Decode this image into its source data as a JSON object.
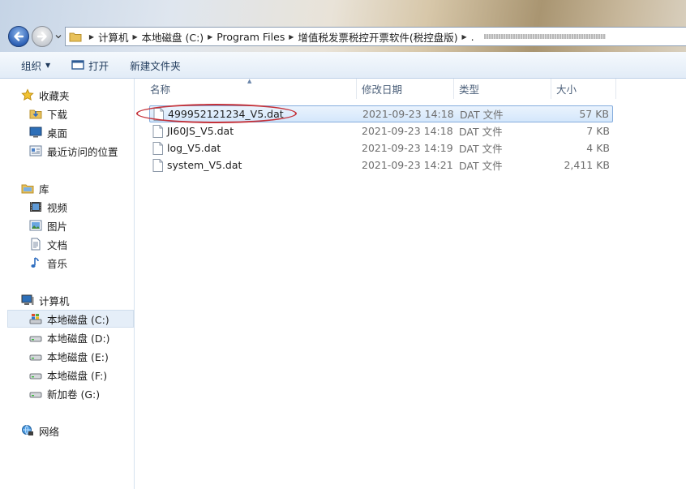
{
  "address": {
    "crumbs": [
      "计算机",
      "本地磁盘 (C:)",
      "Program Files",
      "增值税发票税控开票软件(税控盘版)"
    ],
    "trailing": "."
  },
  "toolbar": {
    "organize_label": "组织",
    "open_label": "打开",
    "new_folder_label": "新建文件夹"
  },
  "sidebar": {
    "favorites_label": "收藏夹",
    "favorites": [
      "下载",
      "桌面",
      "最近访问的位置"
    ],
    "libraries_label": "库",
    "libraries": [
      "视频",
      "图片",
      "文档",
      "音乐"
    ],
    "computer_label": "计算机",
    "drives": [
      "本地磁盘 (C:)",
      "本地磁盘 (D:)",
      "本地磁盘 (E:)",
      "本地磁盘 (F:)",
      "新加卷 (G:)"
    ],
    "network_label": "网络"
  },
  "columns": {
    "name": "名称",
    "date": "修改日期",
    "type": "类型",
    "size": "大小"
  },
  "files": [
    {
      "name": "499952121234_V5.dat",
      "date": "2021-09-23 14:18",
      "type": "DAT 文件",
      "size": "57 KB"
    },
    {
      "name": "JI60JS_V5.dat",
      "date": "2021-09-23 14:18",
      "type": "DAT 文件",
      "size": "7 KB"
    },
    {
      "name": "log_V5.dat",
      "date": "2021-09-23 14:19",
      "type": "DAT 文件",
      "size": "4 KB"
    },
    {
      "name": "system_V5.dat",
      "date": "2021-09-23 14:21",
      "type": "DAT 文件",
      "size": "2,411 KB"
    }
  ],
  "colors": {
    "selection": "#d4e7fb",
    "highlight_oval": "#c4323a",
    "toolbar_text": "#1e395b"
  }
}
